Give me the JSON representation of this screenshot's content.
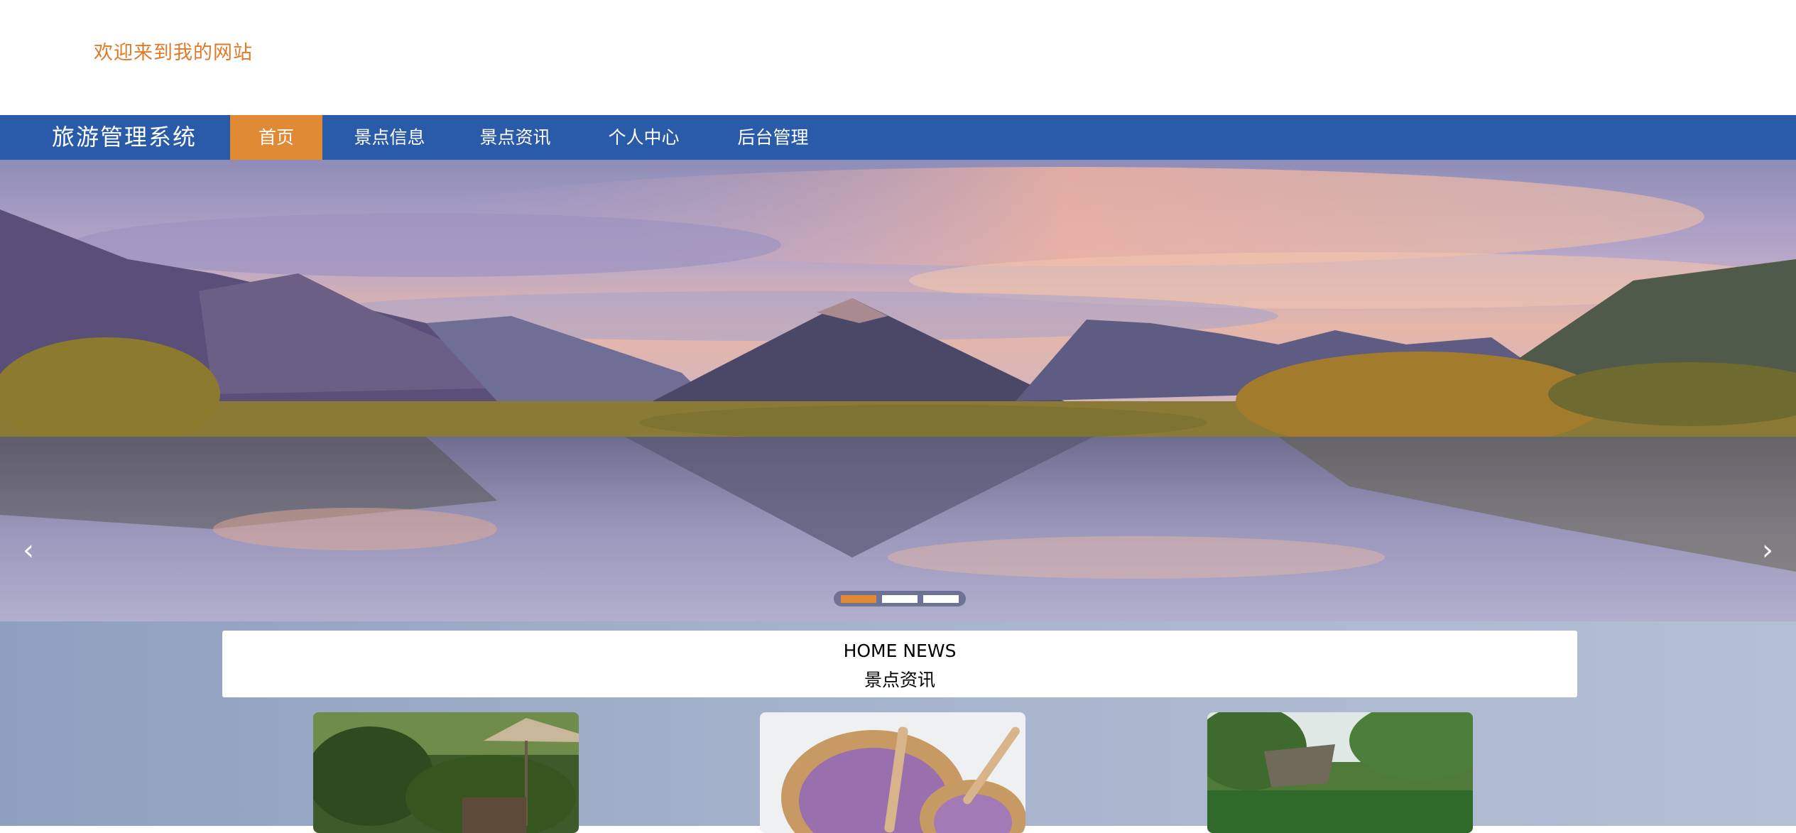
{
  "header": {
    "welcome_text": "欢迎来到我的网站"
  },
  "nav": {
    "brand": "旅游管理系统",
    "items": [
      {
        "label": "首页",
        "active": true
      },
      {
        "label": "景点信息",
        "active": false
      },
      {
        "label": "景点资讯",
        "active": false
      },
      {
        "label": "个人中心",
        "active": false
      },
      {
        "label": "后台管理",
        "active": false
      }
    ]
  },
  "carousel": {
    "prev_icon": "chevron-left-icon",
    "next_icon": "chevron-right-icon",
    "arrow_left": "‹",
    "arrow_right": "›",
    "slide_count": 3,
    "active_slide": 1
  },
  "news_section": {
    "title_en": "HOME NEWS",
    "title_cn": "景点资讯"
  },
  "colors": {
    "nav_bg": "#2a5ba8",
    "accent": "#e08a35",
    "welcome": "#e07a2b"
  }
}
